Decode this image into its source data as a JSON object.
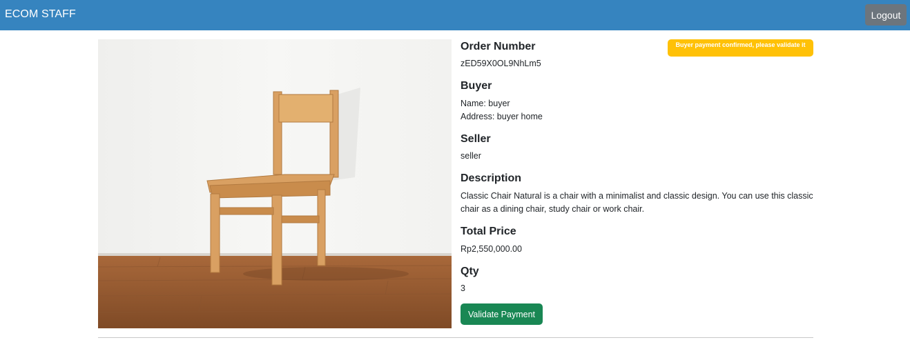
{
  "navbar": {
    "brand": "ECOM STAFF",
    "logout_label": "Logout"
  },
  "order": {
    "status_badge": "Buyer payment confirmed, please validate it",
    "order_number_heading": "Order Number",
    "order_number": "zED59X0OL9NhLm5",
    "buyer_heading": "Buyer",
    "buyer_name": "Name: buyer",
    "buyer_address": "Address: buyer home",
    "seller_heading": "Seller",
    "seller": "seller",
    "description_heading": "Description",
    "description": "Classic Chair Natural is a chair with a minimalist and classic design. You can use this classic chair as a dining chair, study chair or work chair.",
    "total_price_heading": "Total Price",
    "total_price": "Rp2,550,000.00",
    "qty_heading": "Qty",
    "qty": "3",
    "validate_label": "Validate Payment"
  },
  "colors": {
    "navbar": "#3684bf",
    "badge": "#ffc107",
    "validate_button": "#198754",
    "logout_button": "#6c757d"
  }
}
